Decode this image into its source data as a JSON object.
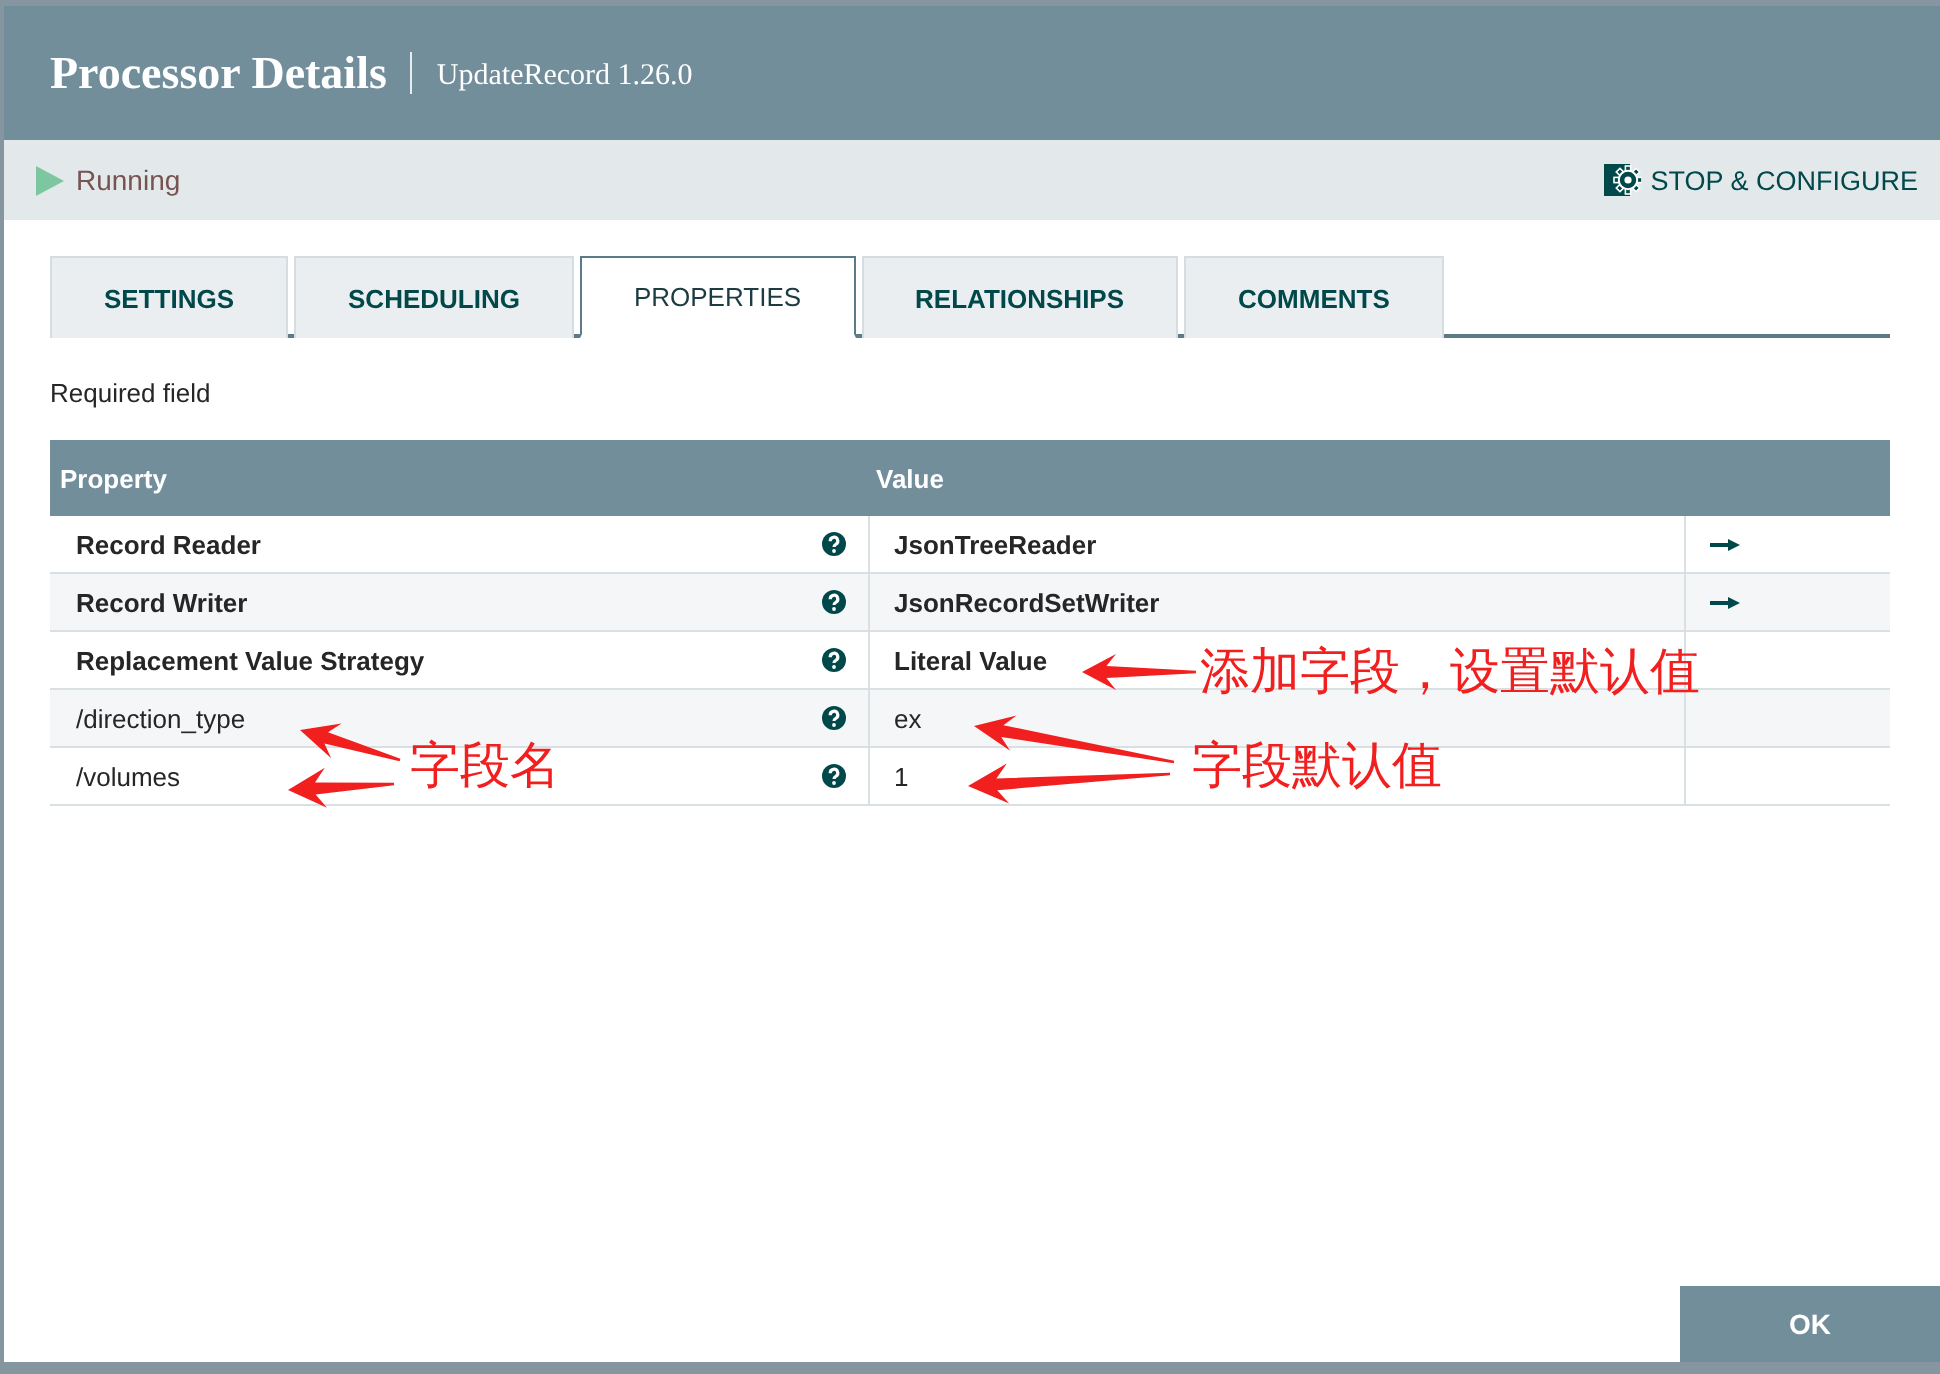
{
  "dialog": {
    "title": "Processor Details",
    "subtitle": "UpdateRecord 1.26.0"
  },
  "status": {
    "running": true,
    "label": "Running",
    "action_button": "STOP & CONFIGURE"
  },
  "tabs": [
    {
      "label": "SETTINGS",
      "selected": false
    },
    {
      "label": "SCHEDULING",
      "selected": false
    },
    {
      "label": "PROPERTIES",
      "selected": true
    },
    {
      "label": "RELATIONSHIPS",
      "selected": false
    },
    {
      "label": "COMMENTS",
      "selected": false
    }
  ],
  "required_note": "Required field",
  "table": {
    "columns": [
      "Property",
      "Value"
    ],
    "rows": [
      {
        "property": "Record Reader",
        "required": true,
        "value": "JsonTreeReader",
        "go_to": true
      },
      {
        "property": "Record Writer",
        "required": true,
        "value": "JsonRecordSetWriter",
        "go_to": true
      },
      {
        "property": "Replacement Value Strategy",
        "required": true,
        "value": "Literal Value",
        "go_to": false
      },
      {
        "property": "/direction_type",
        "required": false,
        "value": "ex",
        "go_to": false
      },
      {
        "property": "/volumes",
        "required": false,
        "value": "1",
        "go_to": false
      }
    ]
  },
  "annotations": [
    {
      "text": "添加字段，设置默认值"
    },
    {
      "text": "字段名"
    },
    {
      "text": "字段默认值"
    }
  ],
  "footer": {
    "ok_button": "OK"
  }
}
